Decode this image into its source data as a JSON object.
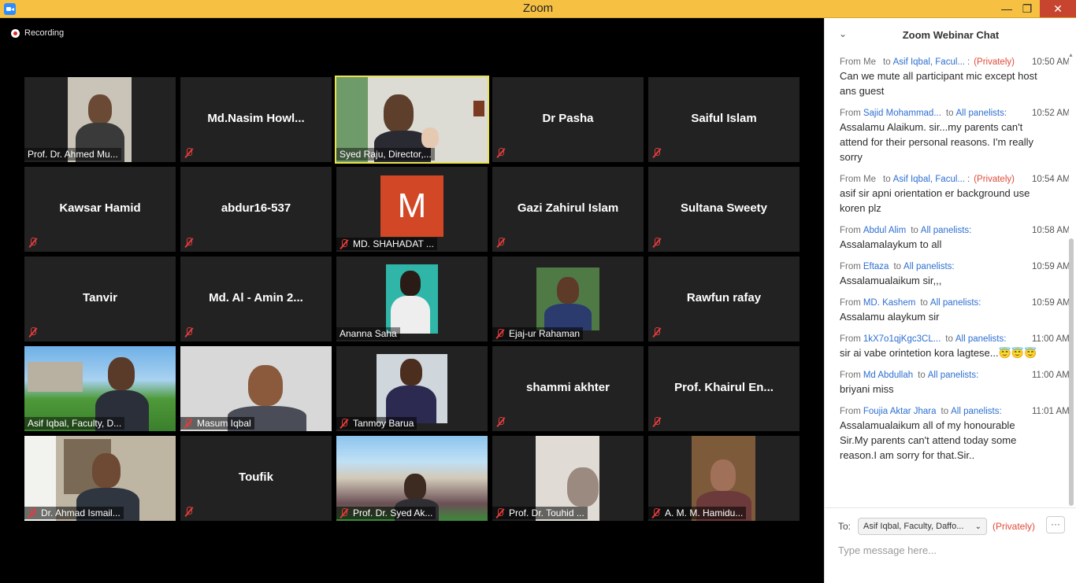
{
  "window": {
    "title": "Zoom",
    "minimize": "—",
    "restore": "❐",
    "close": "✕"
  },
  "recording": {
    "label": "Recording"
  },
  "tiles": [
    {
      "name": "Prof. Dr. Ahmed Mu...",
      "kind": "video",
      "muted": false
    },
    {
      "name": "Md.Nasim  Howl...",
      "kind": "name",
      "muted": true
    },
    {
      "name": "Syed Raju, Director,...",
      "kind": "video",
      "muted": false,
      "active": true
    },
    {
      "name": "Dr Pasha",
      "kind": "name",
      "muted": true
    },
    {
      "name": "Saiful Islam",
      "kind": "name",
      "muted": true
    },
    {
      "name": "Kawsar Hamid",
      "kind": "name",
      "muted": true
    },
    {
      "name": "abdur16-537",
      "kind": "name",
      "muted": true
    },
    {
      "name": "MD. SHAHADAT ...",
      "kind": "avatar",
      "avatar_letter": "M",
      "muted": true
    },
    {
      "name": "Gazi Zahirul Islam",
      "kind": "name",
      "muted": true
    },
    {
      "name": "Sultana Sweety",
      "kind": "name",
      "muted": true
    },
    {
      "name": "Tanvir",
      "kind": "name",
      "muted": true
    },
    {
      "name": "Md. Al - Amin 2...",
      "kind": "name",
      "muted": true
    },
    {
      "name": "Ananna Saha",
      "kind": "video",
      "muted": false
    },
    {
      "name": "Ejaj-ur Rahaman",
      "kind": "video",
      "muted": true
    },
    {
      "name": "Rawfun rafay",
      "kind": "name",
      "muted": true
    },
    {
      "name": "Asif Iqbal, Faculty, D...",
      "kind": "video",
      "muted": false
    },
    {
      "name": "Masum Iqbal",
      "kind": "video",
      "muted": true
    },
    {
      "name": "Tanmoy Barua",
      "kind": "video",
      "muted": true
    },
    {
      "name": "shammi akhter",
      "kind": "name",
      "muted": true
    },
    {
      "name": "Prof. Khairul En...",
      "kind": "name",
      "muted": true
    },
    {
      "name": "Dr. Ahmad Ismail...",
      "kind": "video",
      "muted": true
    },
    {
      "name": "Toufik",
      "kind": "name",
      "muted": true
    },
    {
      "name": "Prof. Dr. Syed Ak...",
      "kind": "video",
      "muted": true
    },
    {
      "name": "Prof. Dr. Touhid ...",
      "kind": "video",
      "muted": true
    },
    {
      "name": "A. M. M. Hamidu...",
      "kind": "video",
      "muted": true
    }
  ],
  "chat": {
    "title": "Zoom Webinar Chat",
    "messages": [
      {
        "from": "From Me",
        "sender": "",
        "to_word": "to",
        "recipient": "Asif Iqbal, Facul...",
        "colon": ":",
        "privately": "(Privately)",
        "time": "10:50 AM",
        "text": "Can we mute all participant mic except host ans guest"
      },
      {
        "from": "From",
        "sender": "Sajid Mohammad...",
        "to_word": "to",
        "recipient": "All panelists:",
        "colon": "",
        "privately": "",
        "time": "10:52 AM",
        "text": "Assalamu Alaikum. sir...my parents can't attend for their personal reasons. I'm really sorry"
      },
      {
        "from": "From Me",
        "sender": "",
        "to_word": "to",
        "recipient": "Asif Iqbal, Facul...",
        "colon": ":",
        "privately": "(Privately)",
        "time": "10:54 AM",
        "text": "asif sir apni orientation er background use koren plz"
      },
      {
        "from": "From",
        "sender": "Abdul Alim",
        "to_word": "to",
        "recipient": "All panelists:",
        "colon": "",
        "privately": "",
        "time": "10:58 AM",
        "text": "Assalamalaykum to all"
      },
      {
        "from": "From",
        "sender": "Eftaza",
        "to_word": "to",
        "recipient": "All panelists:",
        "colon": "",
        "privately": "",
        "time": "10:59 AM",
        "text": "Assalamualaikum sir,,,"
      },
      {
        "from": "From",
        "sender": "MD. Kashem",
        "to_word": "to",
        "recipient": "All panelists:",
        "colon": "",
        "privately": "",
        "time": "10:59 AM",
        "text": "Assalamu alaykum sir"
      },
      {
        "from": "From",
        "sender": "1kX7o1qjKgc3CL...",
        "to_word": "to",
        "recipient": "All panelists:",
        "colon": "",
        "privately": "",
        "time": "11:00 AM",
        "text": "sir ai vabe orintetion kora lagtese...😇😇😇"
      },
      {
        "from": "From",
        "sender": "Md Abdullah",
        "to_word": "to",
        "recipient": "All panelists:",
        "colon": "",
        "privately": "",
        "time": "11:00 AM",
        "text": "briyani miss"
      },
      {
        "from": "From",
        "sender": "Foujia Aktar Jhara",
        "to_word": "to",
        "recipient": "All panelists:",
        "colon": "",
        "privately": "",
        "time": "11:01 AM",
        "text": "Assalamualaikum all of my honourable Sir.My parents can't attend today some reason.I am sorry for that.Sir.."
      }
    ],
    "to_label": "To:",
    "to_value": "Asif Iqbal, Faculty, Daffo...",
    "privately": "(Privately)",
    "more": "···",
    "input_placeholder": "Type message here..."
  }
}
